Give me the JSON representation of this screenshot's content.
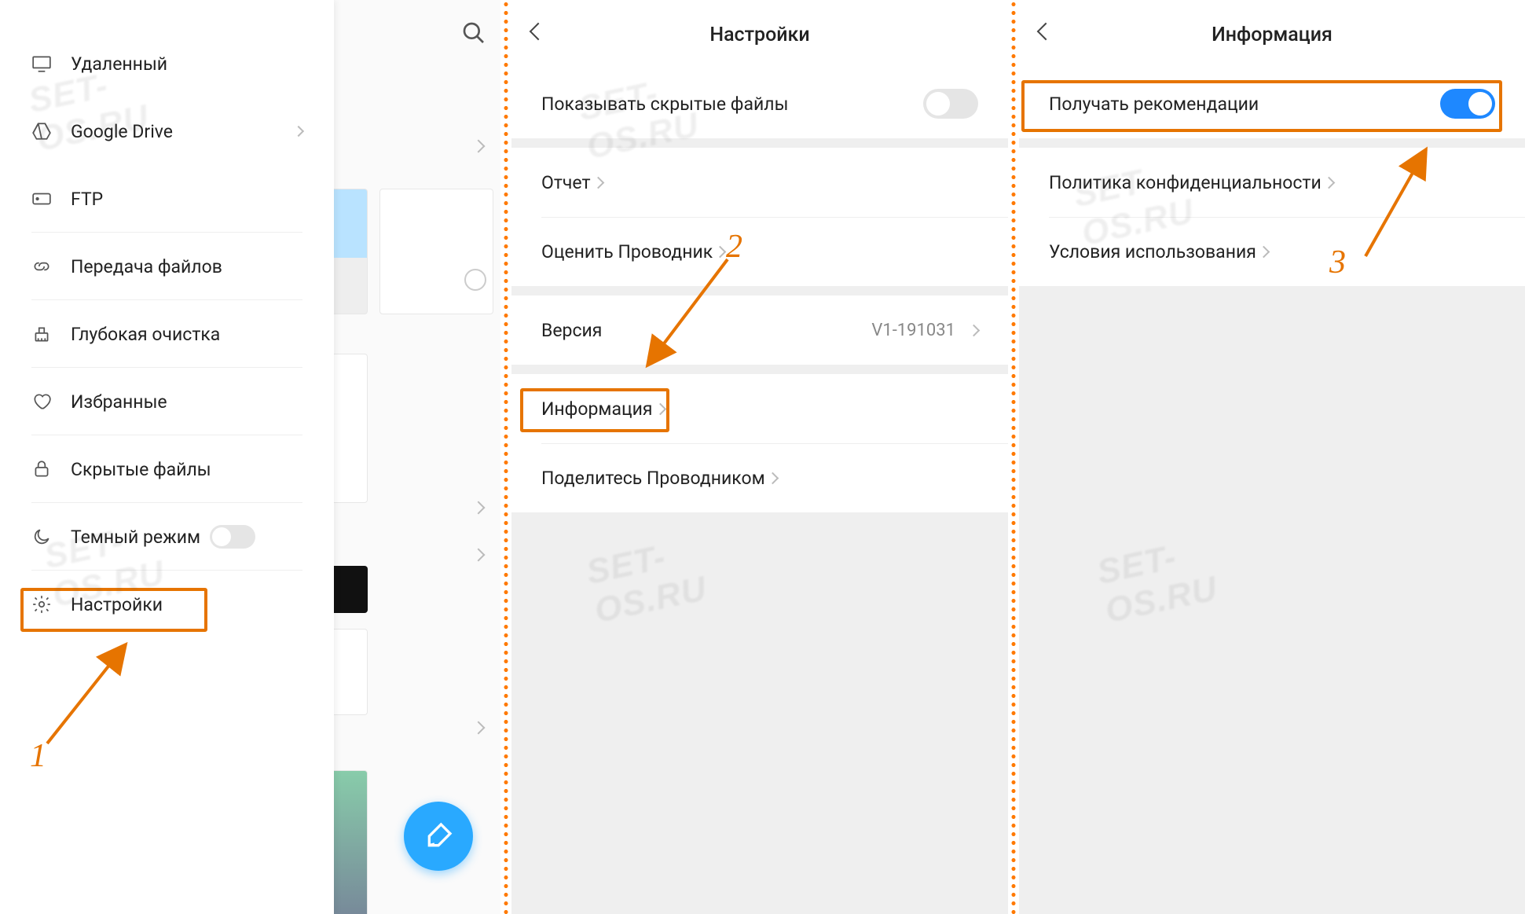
{
  "pane1": {
    "drawer_items": [
      {
        "icon": "monitor",
        "label": "Удаленный"
      },
      {
        "icon": "gdrive",
        "label": "Google Drive"
      },
      {
        "icon": "ftp",
        "label": "FTP"
      },
      {
        "icon": "link",
        "label": "Передача файлов"
      },
      {
        "icon": "clean",
        "label": "Глубокая очистка"
      },
      {
        "icon": "heart",
        "label": "Избранные"
      },
      {
        "icon": "lock",
        "label": "Скрытые файлы"
      },
      {
        "icon": "moon",
        "label": "Темный режим"
      },
      {
        "icon": "gear",
        "label": "Настройки"
      }
    ]
  },
  "pane2": {
    "title": "Настройки",
    "hidden_files": "Показывать скрытые файлы",
    "report": "Отчет",
    "rate": "Оценить Проводник",
    "version_label": "Версия",
    "version_value": "V1-191031",
    "info": "Информация",
    "share": "Поделитесь Проводником"
  },
  "pane3": {
    "title": "Информация",
    "recommend": "Получать рекомендации",
    "privacy": "Политика конфиденциальности",
    "terms": "Условия использования"
  },
  "ann": {
    "n1": "1",
    "n2": "2",
    "n3": "3"
  },
  "watermark": "SET-OS.RU"
}
